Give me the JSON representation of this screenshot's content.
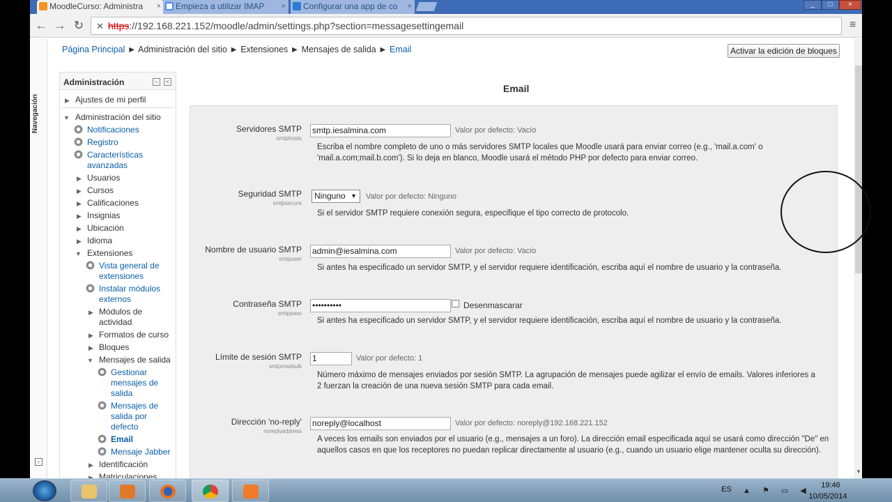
{
  "browser": {
    "tabs": [
      {
        "title": "MoodleCurso: Administra",
        "close": "×"
      },
      {
        "title": "Empieza a utilizar IMAP",
        "close": "×"
      },
      {
        "title": "Configurar una app de co",
        "close": "×"
      }
    ],
    "window_controls": {
      "minimize": "_",
      "maximize": "□",
      "close": "×"
    },
    "nav": {
      "back": "←",
      "forward": "→",
      "reload": "↻"
    },
    "url_icon": "✕",
    "url_scheme": "https",
    "url_rest": "://192.168.221.152/moodle/admin/settings.php?section=messagesettingemail",
    "star": "☆",
    "menu": "≡"
  },
  "page": {
    "nav_dock_label": "Navegación",
    "dock_toggle": "›",
    "breadcrumb": [
      {
        "label": "Página Principal",
        "link": true
      },
      {
        "label": "Administración del sitio",
        "link": false
      },
      {
        "label": "Extensiones",
        "link": false
      },
      {
        "label": "Mensajes de salida",
        "link": false
      },
      {
        "label": "Email",
        "link": true
      }
    ],
    "breadcrumb_sep": "►",
    "edit_blocks_button": "Activar la edición de bloques",
    "title": "Email"
  },
  "admin_block": {
    "title": "Administración",
    "collapse_btn": "–",
    "dock_btn": "<",
    "items": [
      {
        "label": "Ajustes de mi perfil"
      },
      {
        "label": "Administración del sitio"
      },
      {
        "label": "Notificaciones"
      },
      {
        "label": "Registro"
      },
      {
        "label": "Características"
      },
      {
        "label": "avanzadas"
      },
      {
        "label": "Usuarios"
      },
      {
        "label": "Cursos"
      },
      {
        "label": "Calificaciones"
      },
      {
        "label": "Insignias"
      },
      {
        "label": "Ubicación"
      },
      {
        "label": "Idioma"
      },
      {
        "label": "Extensiones"
      },
      {
        "label": "Vista general de"
      },
      {
        "label": "extensiones"
      },
      {
        "label": "Instalar módulos"
      },
      {
        "label": "externos"
      },
      {
        "label": "Módulos de"
      },
      {
        "label": "actividad"
      },
      {
        "label": "Formatos de curso"
      },
      {
        "label": "Bloques"
      },
      {
        "label": "Mensajes de salida"
      },
      {
        "label": "Gestionar"
      },
      {
        "label": "mensajes de"
      },
      {
        "label": "salida"
      },
      {
        "label": "Mensajes de"
      },
      {
        "label": "salida por"
      },
      {
        "label": "defecto"
      },
      {
        "label": "Email"
      },
      {
        "label": "Mensaje Jabber"
      },
      {
        "label": "Identificación"
      },
      {
        "label": "Matriculaciones"
      }
    ]
  },
  "settings": [
    {
      "label": "Servidores SMTP",
      "key": "smtphosts",
      "value": "smtp.iesalmina.com",
      "default": "Valor por defecto: Vacío",
      "desc": "Escriba el nombre completo de uno o más servidores SMTP locales que Moodle usará para enviar correo (e.g., 'mail.a.com' o 'mail.a.com;mail.b.com'). Si lo deja en blanco, Moodle usará el método PHP por defecto para enviar correo."
    },
    {
      "label": "Seguridad SMTP",
      "key": "smtpsecure",
      "value": "Ninguno",
      "default": "Valor por defecto: Ninguno",
      "desc": "Si el servidor SMTP requiere conexión segura, especifique el tipo correcto de protocolo."
    },
    {
      "label": "Nombre de usuario SMTP",
      "key": "smtpuser",
      "value": "admin@iesalmina.com",
      "default": "Valor por defecto: Vacío",
      "desc": "Si antes ha especificado un servidor SMTP, y el servidor requiere identificación, escriba aquí el nombre de usuario y la contraseña."
    },
    {
      "label": "Contraseña SMTP",
      "key": "smtppass",
      "value": "••••••••••",
      "default": "Desenmascarar",
      "desc": "Si antes ha especificado un servidor SMTP, y el servidor requiere identificación, escriba aquí el nombre de usuario y la contraseña."
    },
    {
      "label": "Límite de sesión SMTP",
      "key": "smtpmaxbulk",
      "value": "1",
      "default": "Valor por defecto: 1",
      "desc": "Número máximo de mensajes enviados por sesión SMTP. La agrupación de mensajes puede agilizar el envío de emails. Valores inferiores a 2 fuerzan la creación de una nueva sesión SMTP para cada email."
    },
    {
      "label": "Dirección 'no-reply'",
      "key": "noreplyaddress",
      "value": "noreply@localhost",
      "default": "Valor por defecto: noreply@192.168.221.152",
      "desc": "A veces los emails son enviados por el usuario (e.g., mensajes a un foro). La dirección email especificada aquí se usará como dirección \"De\" en aquellos casos en que los receptores no puedan replicar directamente al usuario (e.g., cuando un usuario elige mantener oculta su dirección)."
    }
  ],
  "select_arrow": "▼",
  "scroll_down": "▼",
  "taskbar": {
    "lang": "ES",
    "tray": "▲ ⚑ ▭ ◀",
    "time": "19:46",
    "date": "10/05/2014"
  },
  "colors": {
    "link": "#0a5ea8",
    "tab_bar": "#3d6bb5",
    "settings_bg": "#eeeeee"
  }
}
